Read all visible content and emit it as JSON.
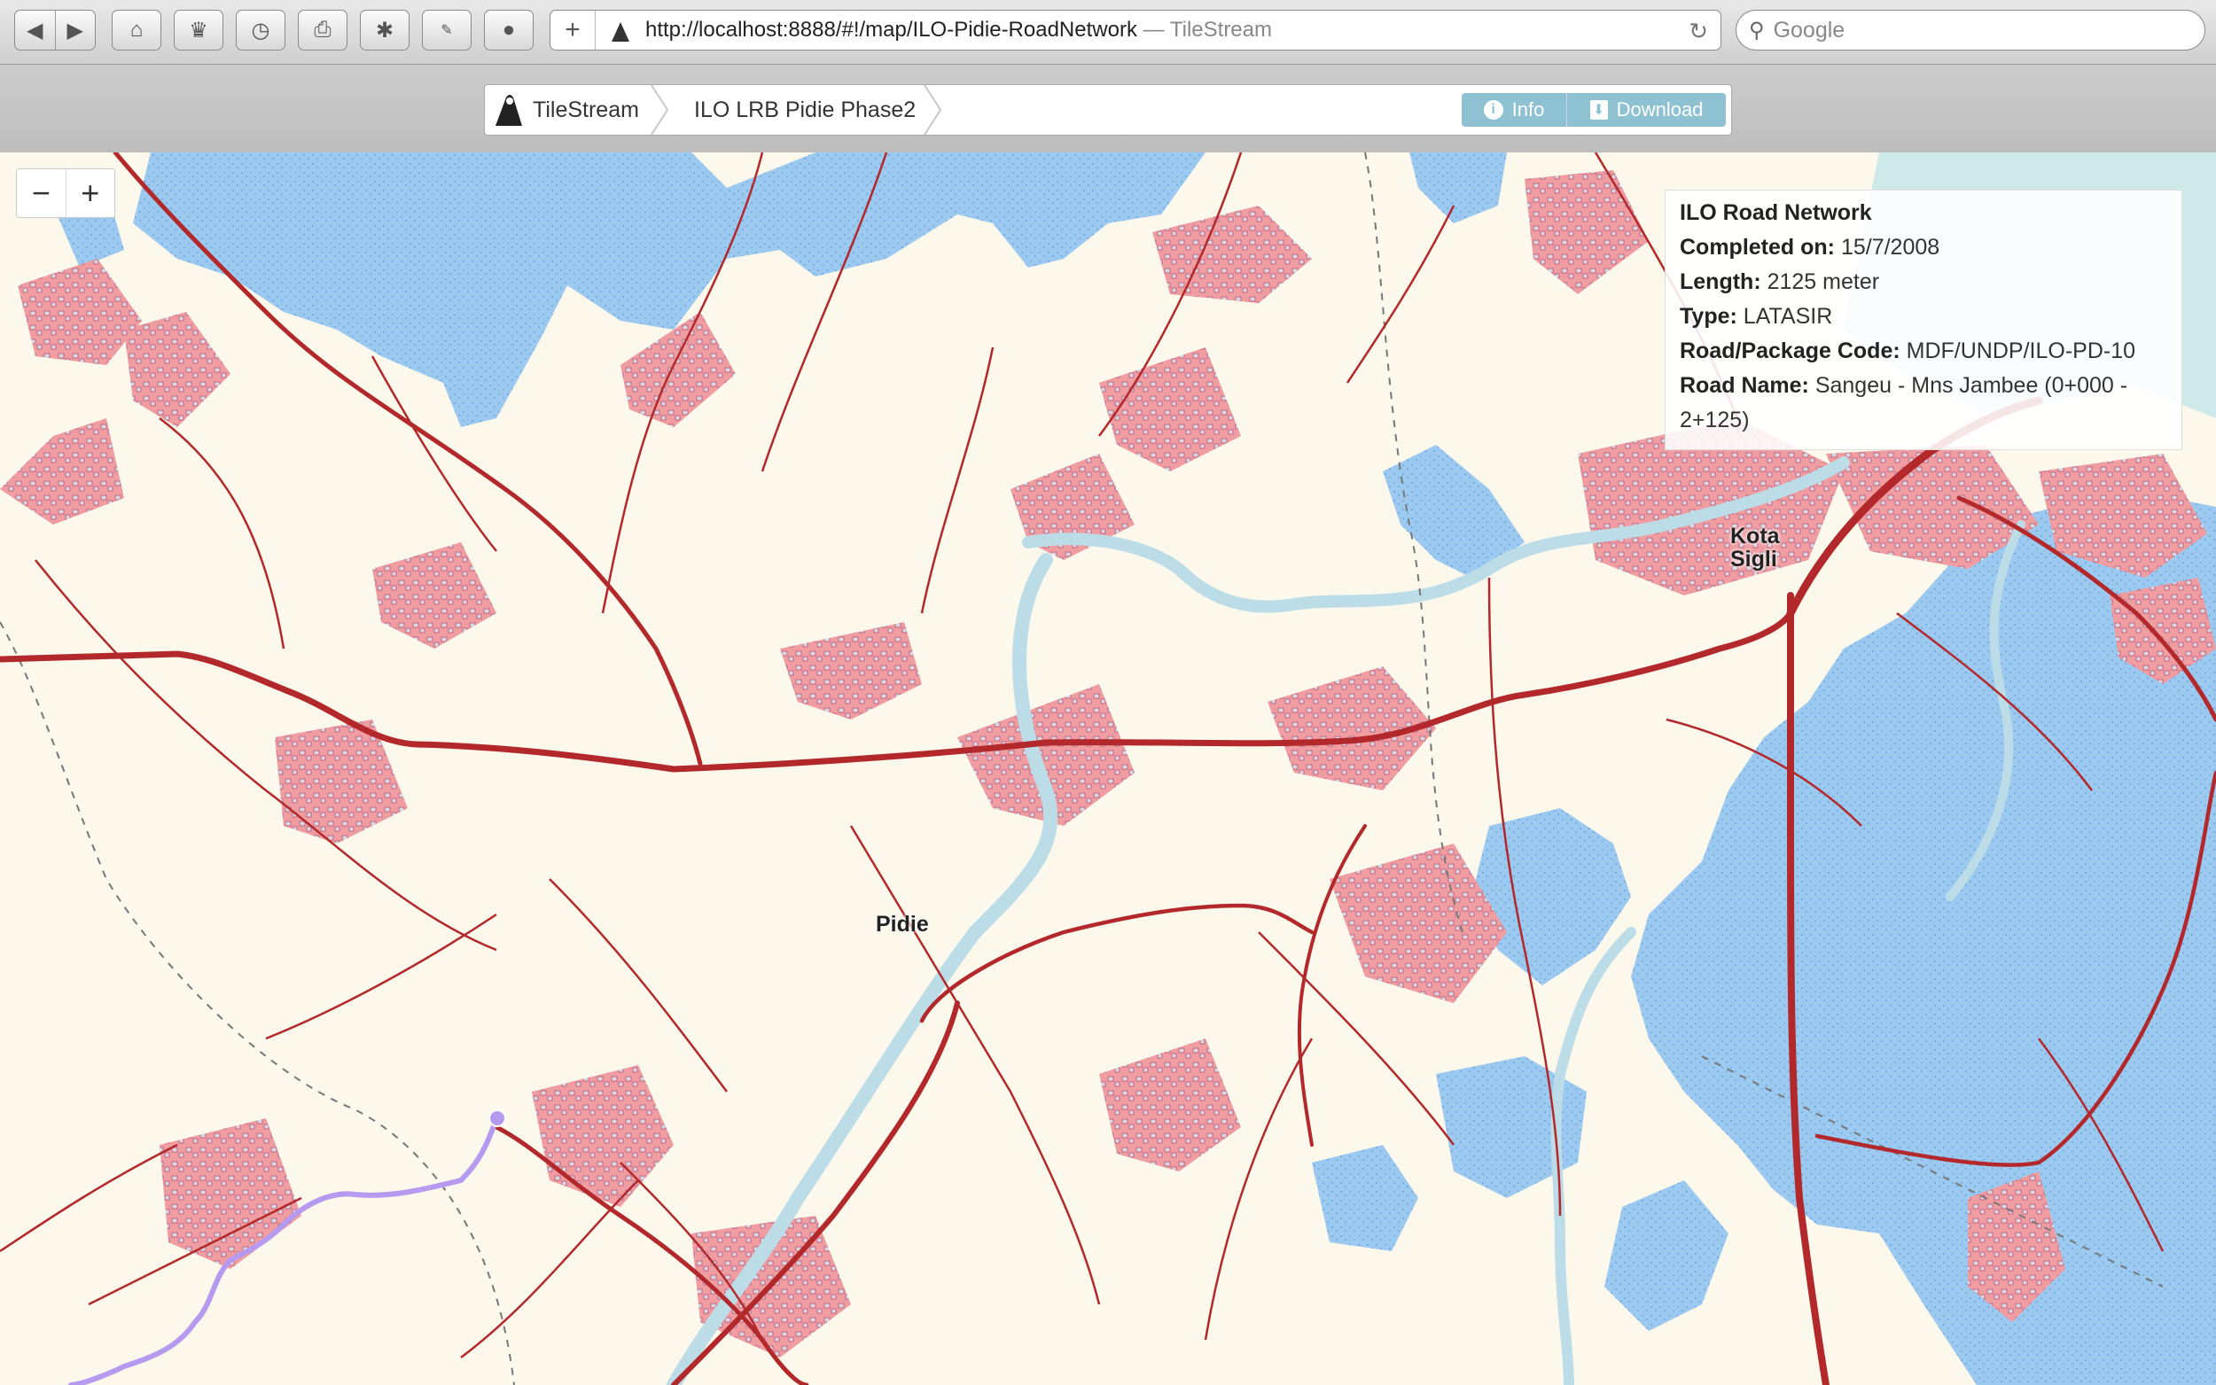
{
  "browser": {
    "url": "http://localhost:8888/#!/map/ILO-Pidie-RoadNetwork",
    "page_title": "— TileStream",
    "search_placeholder": "Google"
  },
  "app": {
    "breadcrumb": [
      "TileStream",
      "ILO LRB Pidie Phase2"
    ],
    "info_label": "Info",
    "download_label": "Download"
  },
  "map": {
    "zoom_out": "−",
    "zoom_in": "+",
    "place_labels": {
      "pidie": "Pidie",
      "kota_line1": "Kota",
      "kota_line2": "Sigli"
    },
    "colors": {
      "land": "#fdf8ec",
      "water": "#9cc9ef",
      "settlement": "#ef9da0",
      "road": "#b3292b",
      "river": "#bcdde8",
      "selected_road": "#b59af0"
    }
  },
  "tooltip": {
    "title": "ILO Road Network",
    "completed_label": "Completed on:",
    "completed_value": "15/7/2008",
    "length_label": "Length:",
    "length_value": "2125 meter",
    "type_label": "Type:",
    "type_value": "LATASIR",
    "code_label": "Road/Package Code:",
    "code_value": "MDF/UNDP/ILO-PD-10",
    "name_label": "Road Name:",
    "name_value": "Sangeu - Mns Jambee (0+000 - 2+125)"
  }
}
